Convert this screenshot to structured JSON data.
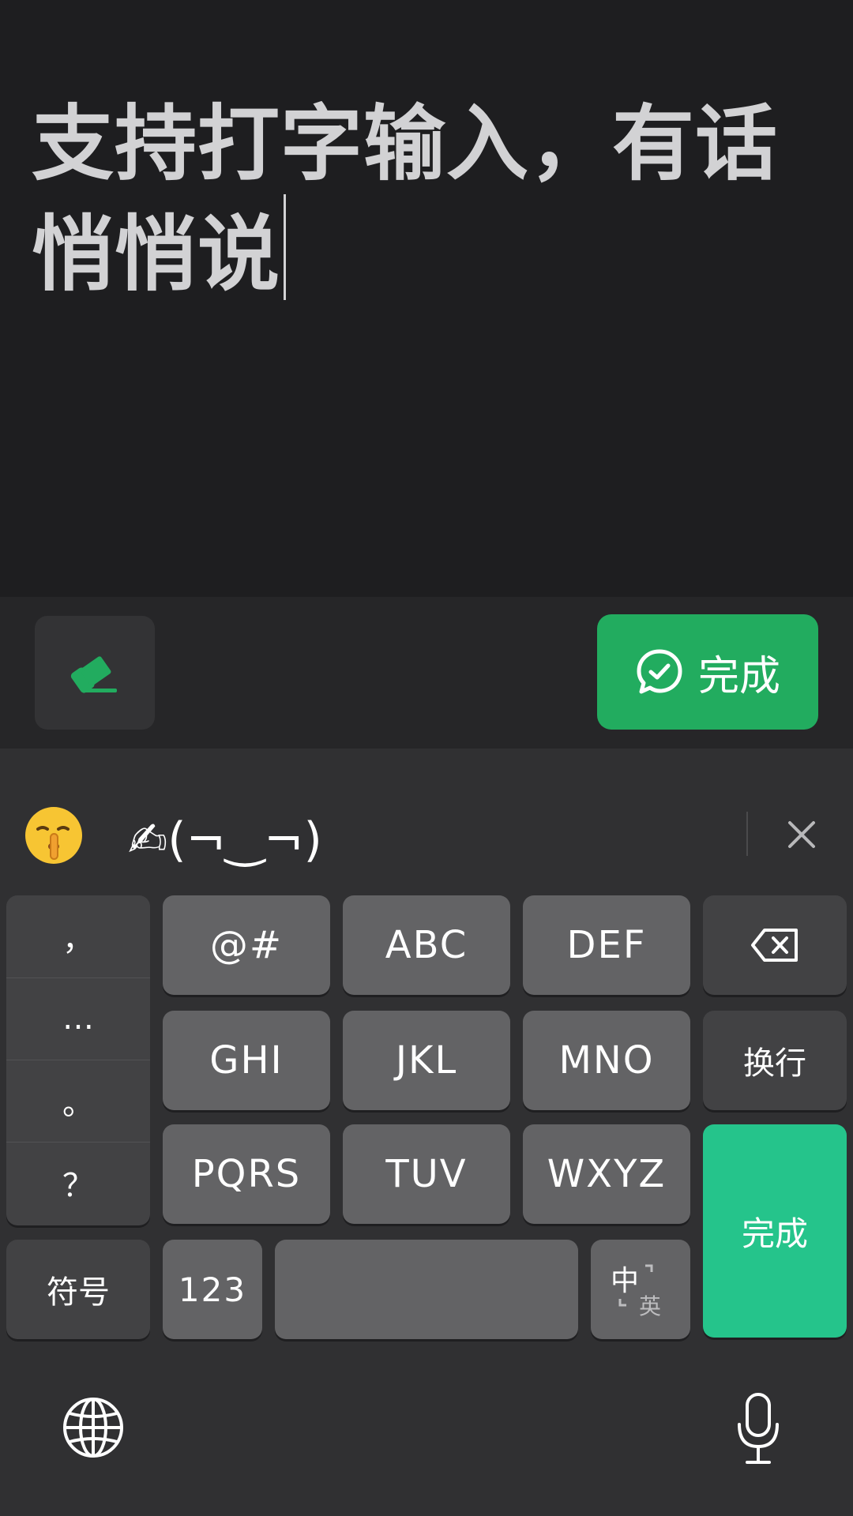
{
  "editor": {
    "text": "支持打字输入，有话悄悄说"
  },
  "action_bar": {
    "eraser_icon": "eraser-icon",
    "done_label": "完成",
    "done_icon": "chat-check-icon",
    "accent_color": "#22ac5f"
  },
  "suggestions": {
    "emoji": "shushing-face-emoji",
    "kaomoji": "✍(¬‿¬)",
    "close_icon": "close-icon"
  },
  "keyboard": {
    "punctuation": [
      "，",
      "…",
      "。",
      "？"
    ],
    "rows": [
      [
        "@#",
        "ABC",
        "DEF"
      ],
      [
        "GHI",
        "JKL",
        "MNO"
      ],
      [
        "PQRS",
        "TUV",
        "WXYZ"
      ]
    ],
    "backspace_icon": "backspace-icon",
    "newline_label": "换行",
    "done_label": "完成",
    "symbols_label": "符号",
    "numbers_label": "123",
    "space_label": "",
    "lang_switch": {
      "primary": "中",
      "secondary": "英"
    },
    "globe_icon": "globe-icon",
    "mic_icon": "microphone-icon",
    "done_color": "#25c48b"
  }
}
